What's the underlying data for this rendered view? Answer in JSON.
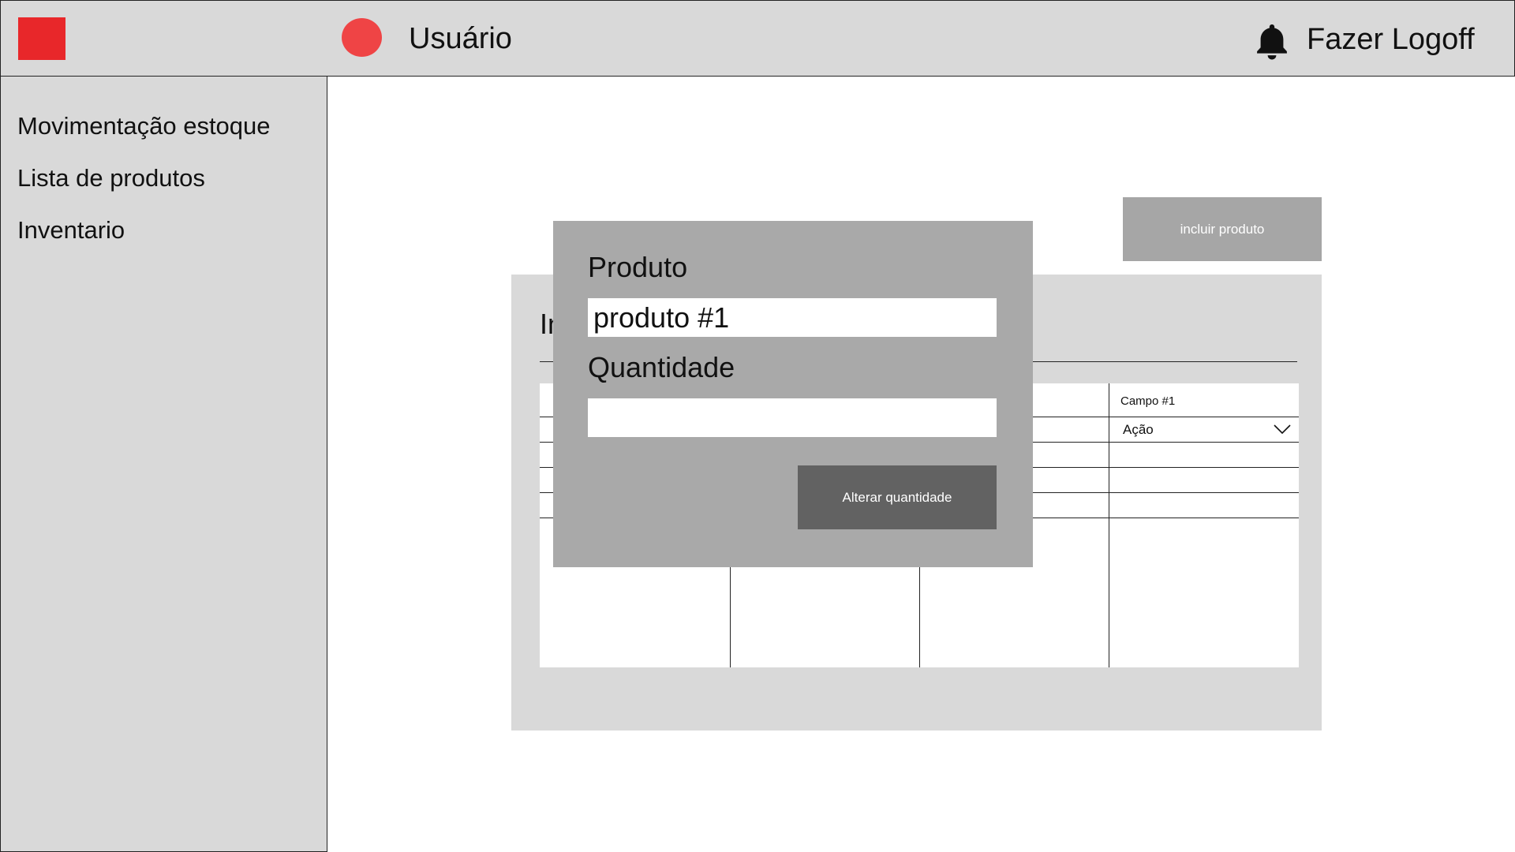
{
  "header": {
    "username": "Usuário",
    "logoff_label": "Fazer Logoff",
    "logo_color": "#e8272a",
    "avatar_color": "#ef4445",
    "bell_icon": "bell-icon"
  },
  "sidebar": {
    "items": [
      {
        "label": "Movimentação estoque"
      },
      {
        "label": "Lista de produtos"
      },
      {
        "label": "Inventario"
      }
    ]
  },
  "main": {
    "add_button_label": "incluir produto",
    "panel_title_partial": "In",
    "table": {
      "column_header": "Campo #1",
      "action_select_value": "Ação"
    }
  },
  "modal": {
    "product_label": "Produto",
    "product_value": "produto #1",
    "quantity_label": "Quantidade",
    "quantity_value": "",
    "submit_label": "Alterar quantidade"
  }
}
